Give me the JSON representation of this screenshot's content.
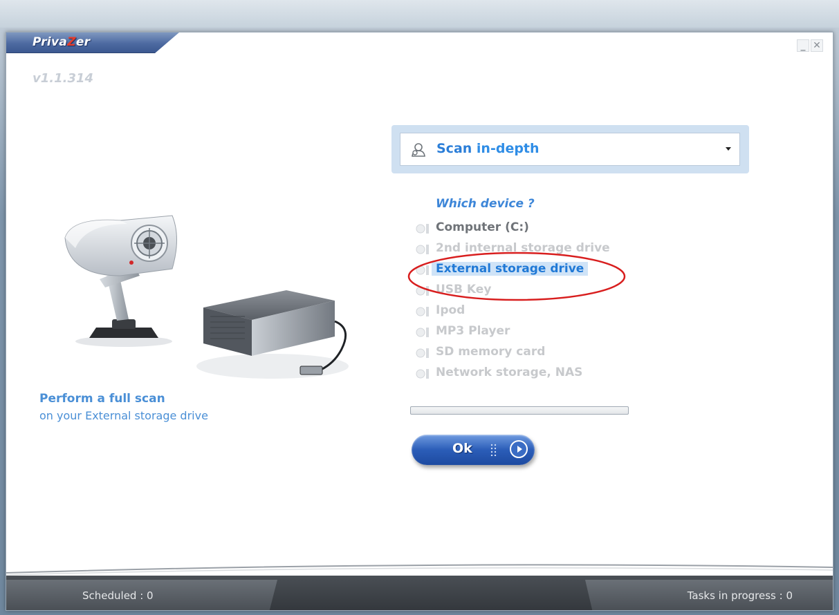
{
  "app": {
    "logo_prefix": "Priva",
    "logo_z": "Z",
    "logo_suffix": "er",
    "version": "v1.1.314"
  },
  "window_controls": {
    "minimize": "_",
    "close": "✕"
  },
  "scan": {
    "mode_prefix": "Scan ",
    "mode_suffix": "in-depth",
    "icon": "user-search-icon"
  },
  "devices": {
    "heading": "Which device ?",
    "items": [
      {
        "label": "Computer  (C:)",
        "state": "active"
      },
      {
        "label": "2nd internal storage drive",
        "state": "disabled"
      },
      {
        "label": "External storage drive",
        "state": "selected"
      },
      {
        "label": "USB Key",
        "state": "disabled"
      },
      {
        "label": "Ipod",
        "state": "disabled"
      },
      {
        "label": "MP3 Player",
        "state": "disabled"
      },
      {
        "label": "SD memory card",
        "state": "disabled"
      },
      {
        "label": "Network storage, NAS",
        "state": "disabled"
      }
    ]
  },
  "caption": {
    "title": "Perform a full scan",
    "subtitle": "on your External storage drive"
  },
  "progress": {
    "value": 0
  },
  "ok_button": {
    "label": "Ok"
  },
  "footer": {
    "scheduled": "Scheduled : 0",
    "tasks": "Tasks in progress : 0"
  },
  "colors": {
    "accent": "#2b7ed8",
    "highlight_ring": "#d81e1e",
    "brand_red": "#e53b2a"
  }
}
